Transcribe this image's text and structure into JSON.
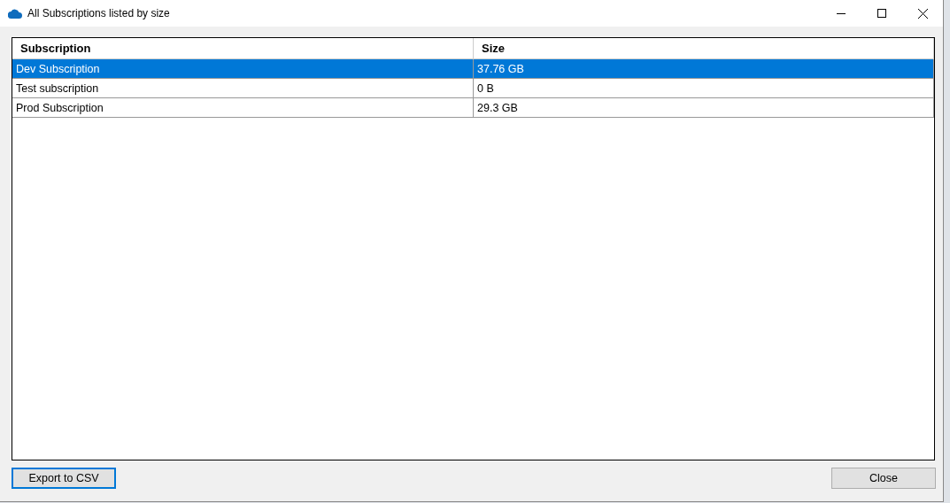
{
  "window": {
    "title": "All Subscriptions listed by size"
  },
  "table": {
    "columns": [
      "Subscription",
      "Size"
    ],
    "rows": [
      {
        "cells": [
          "Dev Subscription",
          "37.76 GB"
        ],
        "selected": true
      },
      {
        "cells": [
          "Test subscription",
          "0 B"
        ],
        "selected": false
      },
      {
        "cells": [
          "Prod Subscription",
          "29.3 GB"
        ],
        "selected": false
      }
    ]
  },
  "buttons": [
    {
      "label": "Export to CSV",
      "focused": true
    },
    {
      "label": "Close",
      "focused": false
    }
  ]
}
